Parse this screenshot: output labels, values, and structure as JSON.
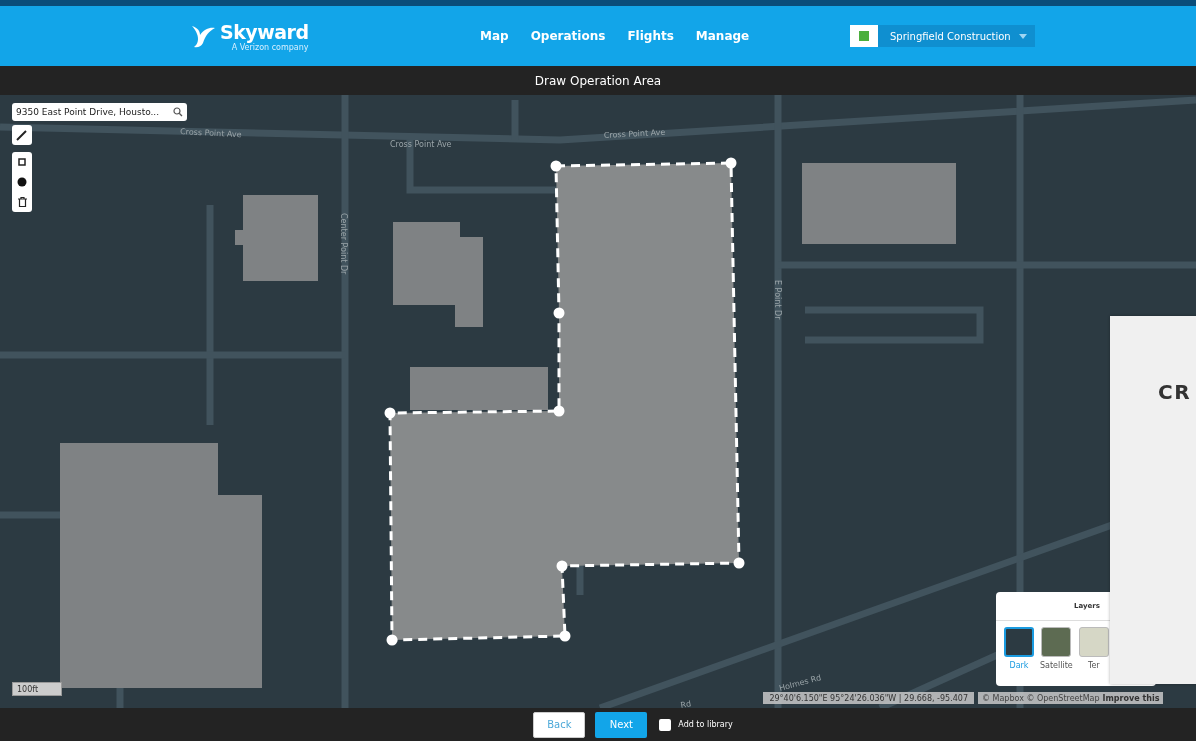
{
  "header": {
    "brand": "Skyward",
    "tagline": "A Verizon company",
    "nav": [
      {
        "label": "Map"
      },
      {
        "label": "Operations"
      },
      {
        "label": "Flights"
      },
      {
        "label": "Manage"
      }
    ],
    "org": {
      "name": "Springfield Construction"
    }
  },
  "title": "Draw Operation Area",
  "search": {
    "value": "9350 East Point Drive, Housto..."
  },
  "map_labels": [
    "Cross Point Ave",
    "Cross Point Ave",
    "Cross Point Ave",
    "Center Point Dr",
    "E Point Dr",
    "Holmes Rd",
    "Rd"
  ],
  "scale": "100ft",
  "coordinates": "29°40'6.150\"E 95°24'26.036\"W | 29.668, -95.407",
  "layers": {
    "title": "Layers",
    "options": [
      {
        "label": "Dark",
        "kind": "dark",
        "selected": true
      },
      {
        "label": "Satellite",
        "kind": "satellite",
        "selected": false
      },
      {
        "label": "Ter",
        "kind": "terrain",
        "selected": false
      }
    ]
  },
  "attribution": {
    "text": "© Mapbox © OpenStreetMap",
    "link": "Improve this"
  },
  "card": {
    "text": "CR"
  },
  "footer": {
    "buttons": [
      {
        "label": "Back",
        "kind": "secondary"
      },
      {
        "label": "Next",
        "kind": "primary"
      }
    ],
    "add_to_library": {
      "label": "Add to library",
      "checked": false
    }
  }
}
